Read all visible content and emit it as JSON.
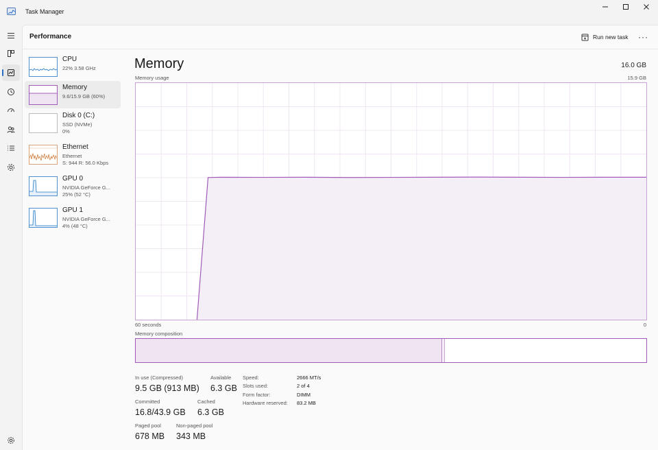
{
  "window": {
    "title": "Task Manager",
    "controls": [
      "minimize",
      "maximize",
      "close"
    ]
  },
  "nav": {
    "items": [
      {
        "icon": "hamburger-menu-icon"
      },
      {
        "icon": "processes-icon"
      },
      {
        "icon": "performance-icon",
        "active": true
      },
      {
        "icon": "app-history-icon"
      },
      {
        "icon": "startup-apps-icon"
      },
      {
        "icon": "users-icon"
      },
      {
        "icon": "details-icon"
      },
      {
        "icon": "services-icon"
      },
      {
        "icon": "settings-icon"
      }
    ]
  },
  "header": {
    "page_title": "Performance",
    "run_new_task": "Run new task",
    "more": "···"
  },
  "perf_list": [
    {
      "name": "CPU",
      "line1": "22%  3.58 GHz",
      "line2": "",
      "color": "#1f77c8"
    },
    {
      "name": "Memory",
      "line1": "9.6/15.9 GB (60%)",
      "line2": "",
      "color": "#a05bb8",
      "selected": true
    },
    {
      "name": "Disk 0 (C:)",
      "line1": "SSD (NVMe)",
      "line2": "0%",
      "color": "#4f9a3a"
    },
    {
      "name": "Ethernet",
      "line1": "Ethernet",
      "line2": "S: 944  R: 56.0 Kbps",
      "color": "#c8702b"
    },
    {
      "name": "GPU 0",
      "line1": "NVIDIA GeForce G...",
      "line2": "25%  (52 °C)",
      "color": "#1f77c8"
    },
    {
      "name": "GPU 1",
      "line1": "NVIDIA GeForce G...",
      "line2": "4%  (48 °C)",
      "color": "#1f77c8"
    }
  ],
  "memory": {
    "title": "Memory",
    "total": "16.0 GB",
    "usage_label": "Memory usage",
    "usage_max": "15.9 GB",
    "x_left": "60 seconds",
    "x_right": "0",
    "composition_label": "Memory composition",
    "composition": {
      "in_use_fraction": 0.6,
      "modified_fraction": 0.006
    },
    "stats": {
      "in_use_label": "In use (Compressed)",
      "in_use_value": "9.5 GB (913 MB)",
      "available_label": "Available",
      "available_value": "6.3 GB",
      "committed_label": "Committed",
      "committed_value": "16.8/43.9 GB",
      "cached_label": "Cached",
      "cached_value": "6.3 GB",
      "paged_label": "Paged pool",
      "paged_value": "678 MB",
      "nonpaged_label": "Non-paged pool",
      "nonpaged_value": "343 MB"
    },
    "details": [
      {
        "label": "Speed:",
        "value": "2666 MT/s"
      },
      {
        "label": "Slots used:",
        "value": "2 of 4"
      },
      {
        "label": "Form factor:",
        "value": "DIMM"
      },
      {
        "label": "Hardware reserved:",
        "value": "83.2 MB"
      }
    ]
  },
  "chart_data": {
    "type": "area",
    "title": "Memory usage",
    "xlabel": "",
    "ylabel": "",
    "x_range_seconds": [
      60,
      0
    ],
    "ylim": [
      0,
      15.9
    ],
    "grid": true,
    "series": [
      {
        "color": "#a05bb8",
        "x": [
          60,
          52.8,
          51.5,
          50,
          45,
          40,
          35,
          30,
          25,
          20,
          15,
          10,
          5,
          0
        ],
        "values": [
          null,
          0,
          9.55,
          9.57,
          9.56,
          9.57,
          9.55,
          9.56,
          9.57,
          9.58,
          9.57,
          9.56,
          9.57,
          9.57
        ]
      }
    ]
  }
}
